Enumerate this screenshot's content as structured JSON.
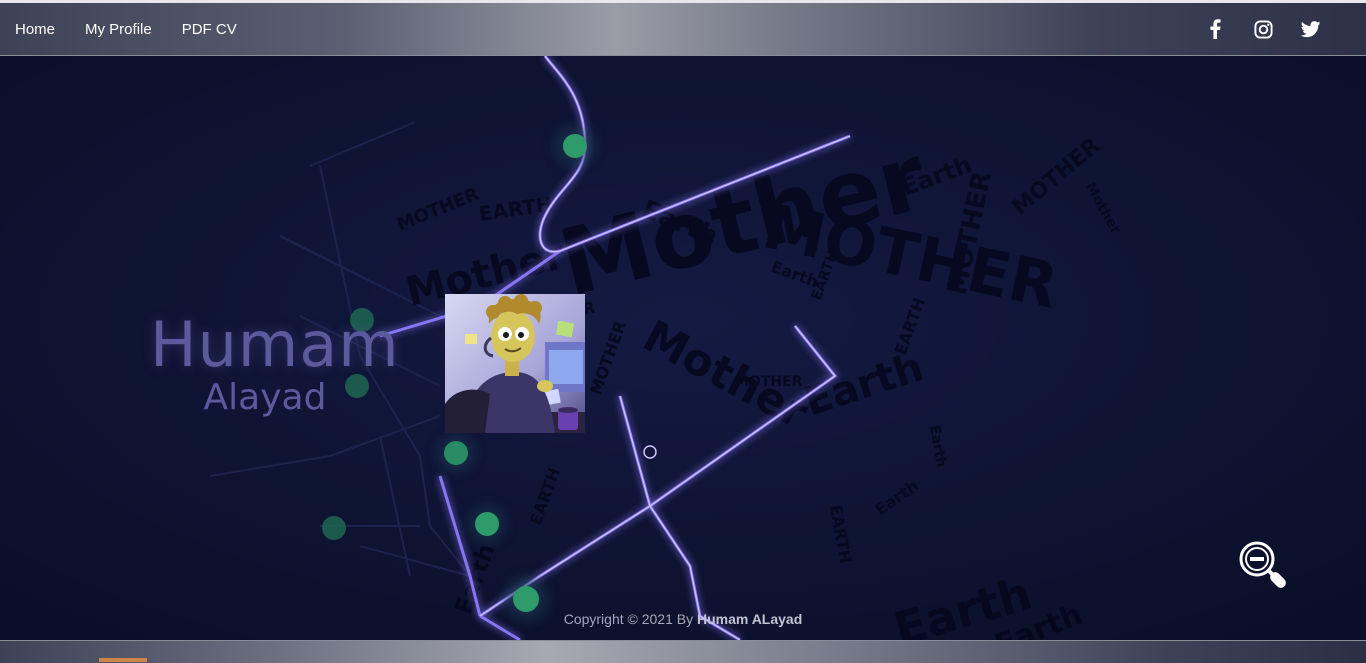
{
  "nav": {
    "links": [
      {
        "label": "Home"
      },
      {
        "label": "My Profile"
      },
      {
        "label": "PDF CV"
      }
    ],
    "social": [
      "facebook-icon",
      "instagram-icon",
      "twitter-icon"
    ]
  },
  "hero": {
    "first_name": "Humam",
    "last_name": "Alayad",
    "avatar": "cartoon-developer-avatar"
  },
  "wordcloud": [
    "Mother",
    "MOTHER",
    "Earth",
    "EARTH",
    "Mother",
    "Earth",
    "MOTHER",
    "Earth",
    "Earth",
    "Mother"
  ],
  "footer": {
    "prefix": "Copyright © 2021 By",
    "author": "Humam ALayad"
  },
  "colors": {
    "background": "#0d1330",
    "route_glow": "#8f7cff",
    "marker": "#2f9a6a",
    "name_text": "#5a5a9c"
  },
  "icons": {
    "zoom": "zoom-out-icon"
  }
}
